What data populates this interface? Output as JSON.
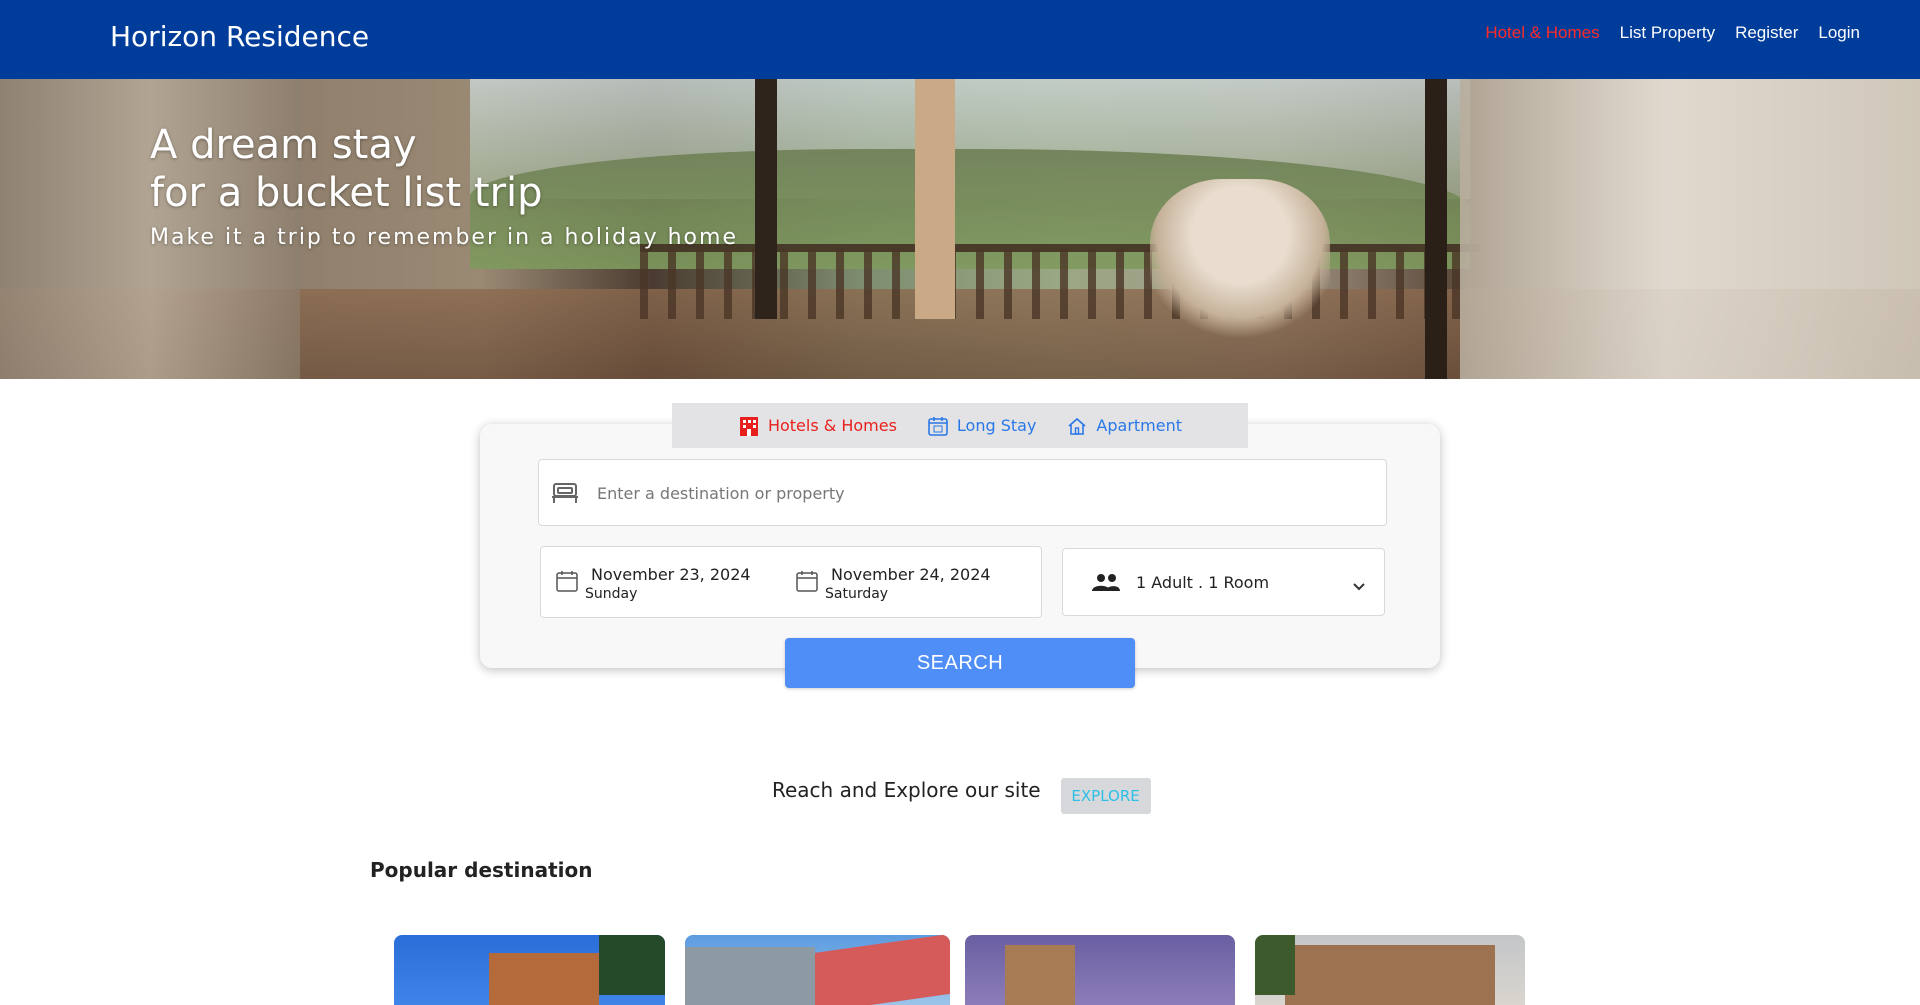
{
  "navbar": {
    "brand": "Horizon Residence",
    "links": [
      "Hotel & Homes",
      "List Property",
      "Register",
      "Login"
    ],
    "active_color": "#ff2a2a",
    "bg_color": "#003d9b"
  },
  "hero": {
    "title_line1": "A dream stay",
    "title_line2": "for a bucket list trip",
    "subtitle": "Make it a trip to remember in a holiday home"
  },
  "search": {
    "tabs": [
      {
        "label": "Hotels & Homes",
        "icon": "hotel-icon",
        "active": true
      },
      {
        "label": "Long Stay",
        "icon": "calendar-icon",
        "active": false
      },
      {
        "label": "Apartment",
        "icon": "home-icon",
        "active": false
      }
    ],
    "destination_placeholder": "Enter a destination or property",
    "checkin_date": "November 23, 2024",
    "checkin_day": "Sunday",
    "checkout_date": "November 24, 2024",
    "checkout_day": "Saturday",
    "guests": "1 Adult . 1 Room",
    "search_label": "SEARCH",
    "button_color": "#4f8ef7"
  },
  "explore": {
    "text": "Reach and Explore our site",
    "button_label": "EXPLORE"
  },
  "popular": {
    "title": "Popular destination"
  }
}
